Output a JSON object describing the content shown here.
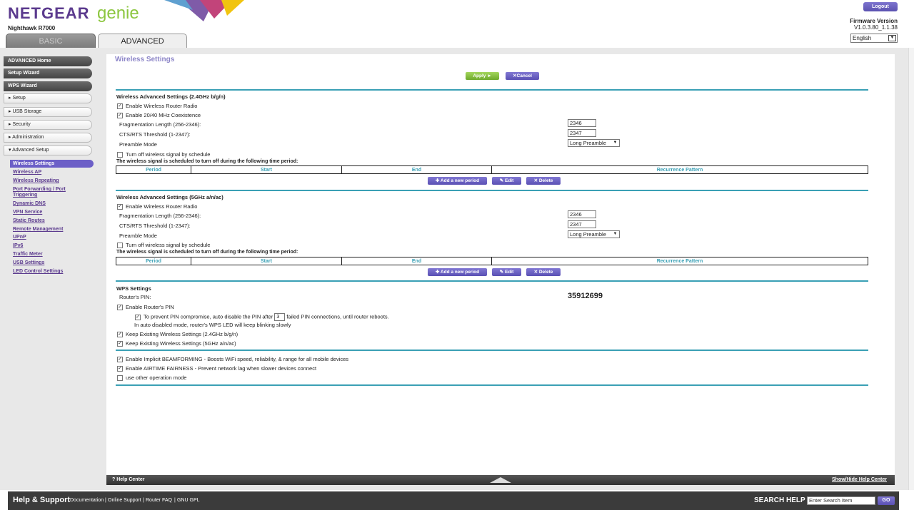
{
  "header": {
    "logo_netgear": "NETGEAR",
    "logo_genie": "genie",
    "model": "Nighthawk R7000",
    "tab_basic": "BASIC",
    "tab_advanced": "ADVANCED",
    "logout": "Logout",
    "firmware_label": "Firmware Version",
    "firmware_value": "V1.0.3.80_1.1.38",
    "language": "English"
  },
  "sidebar": {
    "top_buttons": [
      "ADVANCED Home",
      "Setup Wizard",
      "WPS Wizard"
    ],
    "sections": [
      "▸ Setup",
      "▸ USB Storage",
      "▸ Security",
      "▸ Administration",
      "▾ Advanced Setup"
    ],
    "active_sub": "Wireless Settings",
    "sub_items": [
      "Wireless AP",
      "Wireless Repeating",
      "Port Forwarding / Port",
      "Triggering",
      "Dynamic DNS",
      "VPN Service",
      "Static Routes",
      "Remote Management",
      "UPnP",
      "IPv6",
      "Traffic Meter",
      "USB Settings",
      "LED Control Settings"
    ]
  },
  "main": {
    "title": "Wireless Settings",
    "apply": "Apply ►",
    "cancel": "✕Cancel",
    "band24": {
      "title": "Wireless Advanced Settings (2.4GHz b/g/n)",
      "enable_radio": "Enable Wireless Router Radio",
      "enable_coexist": "Enable 20/40 MHz Coexistence",
      "frag_label": "Fragmentation Length (256-2346):",
      "frag_value": "2346",
      "cts_label": "CTS/RTS Threshold (1-2347):",
      "cts_value": "2347",
      "preamble_label": "Preamble Mode",
      "preamble_value": "Long Preamble",
      "schedule_cb": "Turn off wireless signal by schedule",
      "schedule_title": "The wireless signal is scheduled to turn off during the following time period:"
    },
    "band5": {
      "title": "Wireless Advanced Settings (5GHz a/n/ac)",
      "enable_radio": "Enable Wireless Router Radio",
      "frag_label": "Fragmentation Length (256-2346):",
      "frag_value": "2346",
      "cts_label": "CTS/RTS Threshold (1-2347):",
      "cts_value": "2347",
      "preamble_label": "Preamble Mode",
      "preamble_value": "Long Preamble",
      "schedule_cb": "Turn off wireless signal by schedule",
      "schedule_title": "The wireless signal is scheduled to turn off during the following time period:"
    },
    "schedule_columns": [
      "Period",
      "Start",
      "End",
      "Recurrence Pattern"
    ],
    "add_period": "✚ Add a new period",
    "edit": "✎ Edit",
    "delete": "✕ Delete",
    "wps": {
      "title": "WPS Settings",
      "pin_label": "Router's PIN:",
      "pin_value": "35912699",
      "enable_pin": "Enable Router's PIN",
      "prevent_pre": "To prevent PIN compromise, auto disable the PIN after",
      "prevent_value": "3",
      "prevent_post": "failed PIN connections, until router reboots.",
      "auto_note": "In auto disabled mode, router's WPS LED will keep blinking slowly",
      "keep24": "Keep Existing Wireless Settings (2.4GHz b/g/n)",
      "keep5": "Keep Existing Wireless Settings (5GHz a/n/ac)"
    },
    "beamforming": "Enable Implicit BEAMFORMING - Boosts WiFi speed, reliability, & range for all mobile devices",
    "airtime": "Enable AIRTIME FAIRNESS - Prevent network lag when slower devices connect",
    "other_mode": "use other operation mode"
  },
  "help": {
    "help_center": "Help Center",
    "toggle": "Show/Hide Help Center"
  },
  "footer": {
    "title": "Help & Support",
    "links": [
      "Documentation",
      "Online Support",
      "Router FAQ",
      "GNU GPL"
    ],
    "search_label": "SEARCH HELP",
    "search_placeholder": "Enter Search Item",
    "go": "GO"
  },
  "colors": {
    "brand_purple": "#5b3a8e",
    "accent_teal": "#3aa0b5",
    "apply_green": "#8cc63f"
  }
}
